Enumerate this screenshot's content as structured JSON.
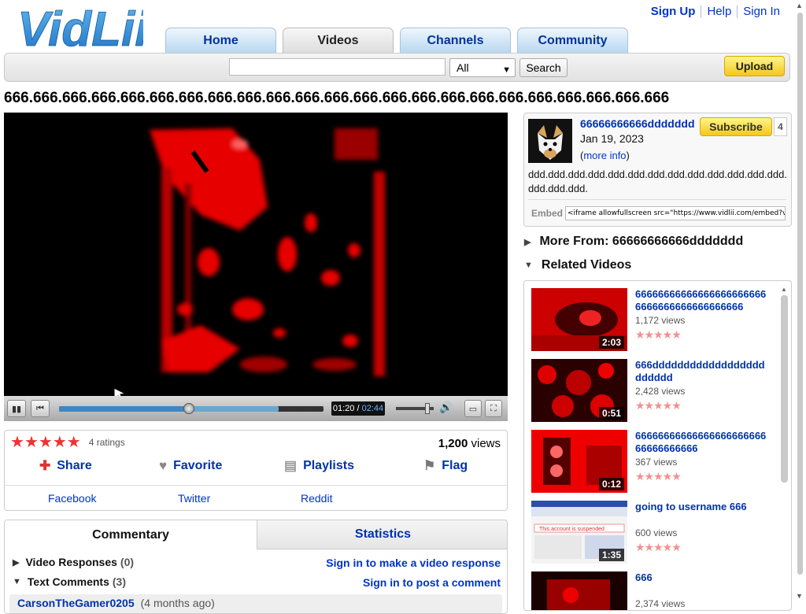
{
  "logo_text": "VidLii",
  "top_links": {
    "signup": "Sign Up",
    "help": "Help",
    "signin": "Sign In"
  },
  "nav_tabs": [
    "Home",
    "Videos",
    "Channels",
    "Community"
  ],
  "nav_active": "Videos",
  "search": {
    "value": "",
    "category": "All",
    "button": "Search"
  },
  "upload_label": "Upload",
  "video": {
    "title": "666.666.666.666.666.666.666.666.666.666.666.666.666.666.666.666.666.666.666.666.666.666.666",
    "current_time": "01:20",
    "duration": "02:44",
    "progress": 0.49,
    "buffered": 0.83,
    "volume": 0.9
  },
  "stats": {
    "rating": 5,
    "ratings_text": "4 ratings",
    "views_number": "1,200",
    "views_label": "views"
  },
  "actions": {
    "share": "Share",
    "favorite": "Favorite",
    "playlists": "Playlists",
    "flag": "Flag"
  },
  "social": {
    "facebook": "Facebook",
    "twitter": "Twitter",
    "reddit": "Reddit"
  },
  "commentary": {
    "tab_commentary": "Commentary",
    "tab_statistics": "Statistics",
    "video_responses_label": "Video Responses",
    "video_responses_count": "(0)",
    "video_response_link": "Sign in to make a video response",
    "text_comments_label": "Text Comments",
    "text_comments_count": "(3)",
    "comment_link": "Sign in to post a comment",
    "first_comment_author": "CarsonTheGamer0205",
    "first_comment_time": "(4 months ago)"
  },
  "uploader": {
    "name": "66666666666ddddddd",
    "date": "Jan 19, 2023",
    "more_info_prefix": "(",
    "more_info": "more info",
    "more_info_suffix": ")",
    "subscribe": "Subscribe",
    "subscriber_count": "4",
    "description": "ddd.ddd.ddd.ddd.ddd.ddd.ddd.ddd.ddd.ddd.ddd.ddd.ddd.ddd.ddd.ddd.",
    "embed_label": "Embed",
    "embed_code": "<iframe allowfullscreen src=\"https://www.vidlii.com/embed?v=E"
  },
  "more_from": "More From: 66666666666ddddddd",
  "related_heading": "Related Videos",
  "related": [
    {
      "title": "666666666666666666666666666666666666666666",
      "views": "1,172 views",
      "duration": "2:03",
      "stars": "★★★★★"
    },
    {
      "title": "666dddddddddddddddddddddddd",
      "views": "2,428 views",
      "duration": "0:51",
      "stars": "★★★★★"
    },
    {
      "title": "6666666666666666666666666666666666",
      "views": "367 views",
      "duration": "0:12",
      "stars": "★★★★★"
    },
    {
      "title": "going to username 666",
      "views": "600 views",
      "duration": "1:35",
      "stars": "★★★★★"
    },
    {
      "title": "666",
      "views": "2,374 views",
      "duration": "",
      "stars": ""
    }
  ],
  "related_thumb_caption": "This account is suspended",
  "colors": {
    "link": "#0033aa",
    "star": "#ee3333",
    "accent_button": "#f2c81c",
    "tab_blue": "#b9d8f1"
  }
}
